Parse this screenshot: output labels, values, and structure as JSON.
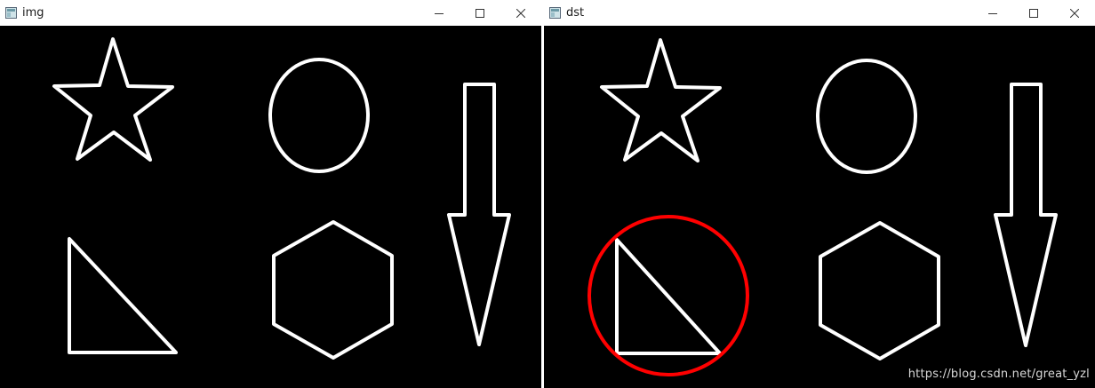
{
  "windows": {
    "left": {
      "title": "img",
      "controls": [
        "minimize-icon",
        "maximize-icon",
        "close-icon"
      ]
    },
    "right": {
      "title": "dst",
      "controls": [
        "minimize-icon",
        "maximize-icon",
        "close-icon"
      ]
    }
  },
  "watermark": "https://blog.csdn.net/great_yzl",
  "colors": {
    "canvas_bg": "#000000",
    "shape_stroke": "#ffffff",
    "highlight_circle": "#ff0000",
    "titlebar_bg": "#ffffff"
  },
  "shapes": [
    "star",
    "ellipse",
    "arrow-down",
    "right-triangle",
    "hexagon"
  ],
  "highlight": {
    "shape": "right-triangle",
    "marker": "circle"
  }
}
